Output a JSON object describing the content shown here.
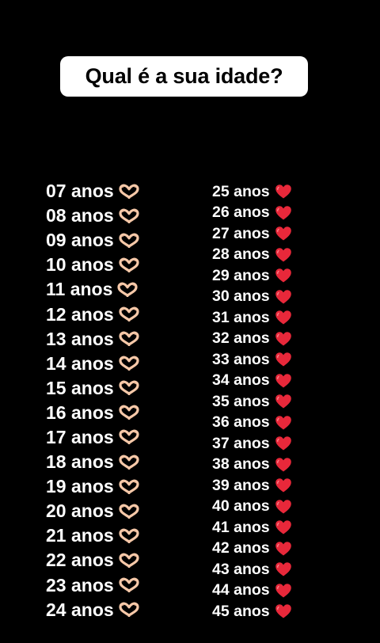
{
  "question": "Qual é a sua idade?",
  "left_column": [
    {
      "label": "07 anos",
      "icon": "heart-hands-icon"
    },
    {
      "label": "08 anos",
      "icon": "heart-hands-icon"
    },
    {
      "label": "09 anos",
      "icon": "heart-hands-icon"
    },
    {
      "label": "10 anos",
      "icon": "heart-hands-icon"
    },
    {
      "label": "11 anos",
      "icon": "heart-hands-icon"
    },
    {
      "label": "12 anos",
      "icon": "heart-hands-icon"
    },
    {
      "label": "13 anos",
      "icon": "heart-hands-icon"
    },
    {
      "label": "14 anos",
      "icon": "heart-hands-icon"
    },
    {
      "label": "15 anos",
      "icon": "heart-hands-icon"
    },
    {
      "label": "16 anos",
      "icon": "heart-hands-icon"
    },
    {
      "label": "17 anos",
      "icon": "heart-hands-icon"
    },
    {
      "label": "18 anos",
      "icon": "heart-hands-icon"
    },
    {
      "label": "19 anos",
      "icon": "heart-hands-icon"
    },
    {
      "label": "20 anos",
      "icon": "heart-hands-icon"
    },
    {
      "label": "21 anos",
      "icon": "heart-hands-icon"
    },
    {
      "label": "22 anos",
      "icon": "heart-hands-icon"
    },
    {
      "label": "23 anos",
      "icon": "heart-hands-icon"
    },
    {
      "label": "24 anos",
      "icon": "heart-hands-icon"
    }
  ],
  "right_column": [
    {
      "label": "25 anos",
      "icon": "heart-icon"
    },
    {
      "label": "26 anos",
      "icon": "heart-icon"
    },
    {
      "label": "27 anos",
      "icon": "heart-icon"
    },
    {
      "label": "28 anos",
      "icon": "heart-icon"
    },
    {
      "label": "29 anos",
      "icon": "heart-icon"
    },
    {
      "label": "30 anos",
      "icon": "heart-icon"
    },
    {
      "label": "31 anos",
      "icon": "heart-icon"
    },
    {
      "label": "32 anos",
      "icon": "heart-icon"
    },
    {
      "label": "33 anos",
      "icon": "heart-icon"
    },
    {
      "label": "34 anos",
      "icon": "heart-icon"
    },
    {
      "label": "35 anos",
      "icon": "heart-icon"
    },
    {
      "label": "36 anos",
      "icon": "heart-icon"
    },
    {
      "label": "37 anos",
      "icon": "heart-icon"
    },
    {
      "label": "38 anos",
      "icon": "heart-icon"
    },
    {
      "label": "39 anos",
      "icon": "heart-icon"
    },
    {
      "label": "40 anos",
      "icon": "heart-icon"
    },
    {
      "label": "41 anos",
      "icon": "heart-icon"
    },
    {
      "label": "42 anos",
      "icon": "heart-icon"
    },
    {
      "label": "43 anos",
      "icon": "heart-icon"
    },
    {
      "label": "44 anos",
      "icon": "heart-icon"
    },
    {
      "label": "45 anos",
      "icon": "heart-icon"
    }
  ],
  "colors": {
    "background": "#000000",
    "text": "#ffffff",
    "question_bg": "#ffffff",
    "question_text": "#000000",
    "heart": "#e8283a",
    "hand_skin": "#f6c8a8"
  }
}
